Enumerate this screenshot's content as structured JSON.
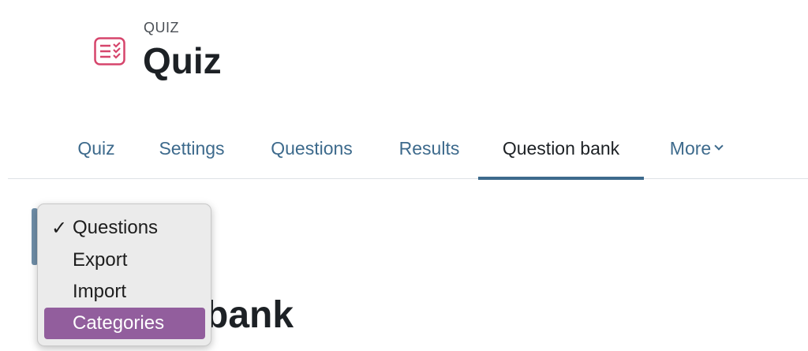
{
  "header": {
    "kicker": "QUIZ",
    "title": "Quiz",
    "icon": "quiz-list-icon",
    "icon_color": "#d6456c"
  },
  "tabs": [
    {
      "label": "Quiz",
      "active": false
    },
    {
      "label": "Settings",
      "active": false
    },
    {
      "label": "Questions",
      "active": false
    },
    {
      "label": "Results",
      "active": false
    },
    {
      "label": "Question bank",
      "active": true
    },
    {
      "label": "More",
      "active": false
    }
  ],
  "colors": {
    "link": "#3d6a8c",
    "highlight": "#925e9d"
  },
  "page_heading_visible": "bank",
  "dropdown": {
    "options": [
      {
        "label": "Questions",
        "checked": true
      },
      {
        "label": "Export",
        "checked": false
      },
      {
        "label": "Import",
        "checked": false
      },
      {
        "label": "Categories",
        "checked": false,
        "highlighted": true
      }
    ],
    "check_glyph": "✓"
  }
}
